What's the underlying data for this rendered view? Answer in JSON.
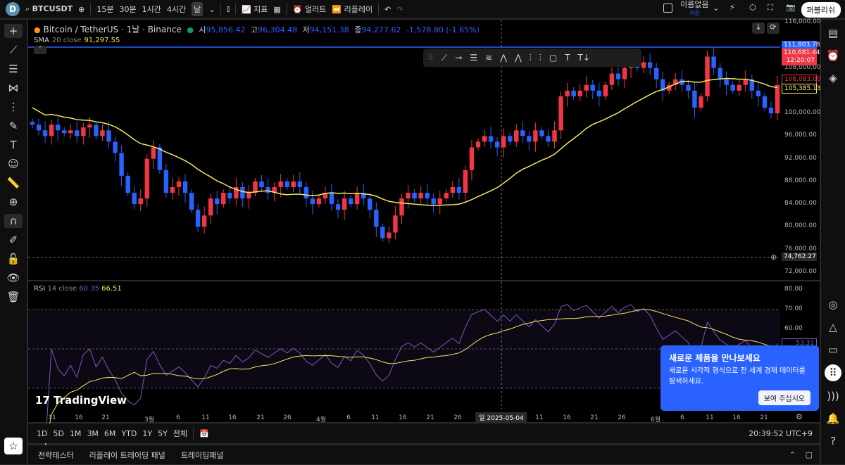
{
  "topbar": {
    "avatar": "D",
    "symbol": "BTCUSDT",
    "intervals": [
      "15분",
      "30분",
      "1시간",
      "4시간",
      "날"
    ],
    "indicators": "지표",
    "alert": "얼러트",
    "replay": "리플레이",
    "layout_name": "이름없음",
    "layout_status": "저장",
    "publish": "퍼블리쉬"
  },
  "legend": {
    "title": "Bitcoin / TetherUS · 1날 · Binance",
    "o_label": "시",
    "o": "95,856.42",
    "h_label": "고",
    "h": "96,304.48",
    "l_label": "저",
    "l": "94,151.38",
    "c_label": "종",
    "c": "94,277.62",
    "change": "-1,578.80 (-1.65%)",
    "sma_label": "SMA",
    "sma_params": "20 close",
    "sma_value": "91,297.55"
  },
  "rsi_legend": {
    "label": "RSI",
    "params": "14 close",
    "rsi": "60.35",
    "ma": "66.51"
  },
  "price_axis": [
    "116,000.00",
    "108,000.00",
    "104,000.00",
    "100,000.00",
    "96,000.00",
    "92,000.00",
    "88,000.00",
    "84,000.00",
    "80,000.00",
    "76,000.00",
    "72,000.00"
  ],
  "price_labels": {
    "line": "111,803.78",
    "last": "110,681.44",
    "countdown": "12:20:07",
    "high": "106,083.00",
    "sma": "105,385.13",
    "cross": "74,762.27"
  },
  "rsi_axis": [
    "80.00",
    "70.00",
    "60.00"
  ],
  "rsi_label": "53.31",
  "time_axis": [
    "11",
    "16",
    "21",
    "3월",
    "6",
    "11",
    "16",
    "21",
    "26",
    "4월",
    "6",
    "11",
    "16",
    "21",
    "26",
    "일 2025-05-04",
    "11",
    "16",
    "21",
    "26",
    "6월",
    "6",
    "11",
    "16",
    "21"
  ],
  "ranges": [
    "1D",
    "5D",
    "1M",
    "3M",
    "6M",
    "YTD",
    "1Y",
    "5Y",
    "전체"
  ],
  "clock": "20:39:52 UTC+9",
  "bottom_tabs": [
    "전략테스터",
    "리플레이 트레이딩 패널",
    "트레이딩패널"
  ],
  "toast": {
    "title": "새로운 제품을 만나보세요",
    "body": "새로운 시각적 형식으로 전 세계 경제 데이터를 탐색하세요.",
    "button": "보여 주십시오"
  },
  "watermark": "TradingView",
  "colors": {
    "up": "#f23645",
    "down": "#2962ff",
    "sma": "#f5e663",
    "rsi": "#7e57c2",
    "accent": "#2962ff"
  },
  "chart_data": {
    "type": "candlestick",
    "unit": "thousand USDT",
    "closes": [
      98,
      97,
      96,
      98,
      97,
      96.5,
      97,
      96,
      97.5,
      98,
      96,
      97,
      95,
      93,
      89,
      86,
      84,
      85,
      92,
      94,
      90,
      86,
      87,
      88,
      86,
      83,
      80,
      82,
      85,
      84,
      86,
      85,
      87,
      85,
      86,
      88,
      87,
      86,
      87,
      88,
      87,
      88,
      87,
      85,
      84,
      85,
      86,
      84,
      83,
      85,
      84,
      86,
      85,
      83,
      80,
      78,
      79,
      82,
      85,
      86,
      85,
      86,
      85,
      84,
      85,
      86,
      87,
      86,
      90,
      94,
      95,
      96,
      95,
      94,
      96,
      95,
      97,
      96,
      95,
      97,
      96,
      95,
      97,
      103,
      104,
      103,
      104,
      105,
      104,
      103,
      105,
      107,
      106,
      108,
      109,
      108,
      109,
      108,
      106,
      104,
      105,
      106,
      105,
      104,
      101,
      103,
      110,
      108,
      106,
      105,
      104,
      105,
      106,
      104,
      103,
      101,
      100,
      105
    ],
    "ylim": [
      72000,
      116000
    ]
  }
}
